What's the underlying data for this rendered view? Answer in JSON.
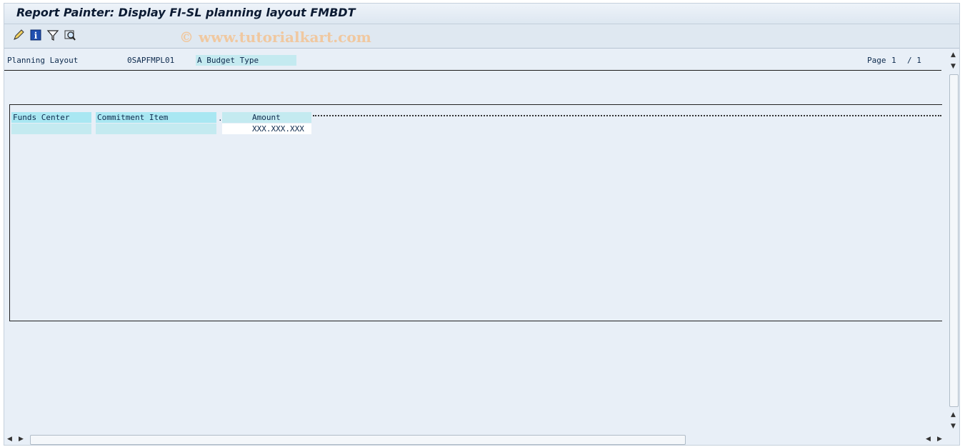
{
  "window": {
    "title": "Report Painter: Display FI-SL planning layout FMBDT"
  },
  "watermark": "© www.tutorialkart.com",
  "toolbar": {
    "icons": [
      "edit-pencil-icon",
      "info-icon",
      "filter-icon",
      "find-icon"
    ]
  },
  "header": {
    "label": "Planning Layout",
    "layout_id": "0SAPFMPL01",
    "description": "A Budget Type",
    "page_label": "Page",
    "page_current": "1",
    "page_total": "/ 1"
  },
  "table": {
    "columns": [
      "Funds Center",
      "Commitment Item",
      "Amount"
    ],
    "amount_value": "XXX.XXX.XXX"
  },
  "colors": {
    "cyan": "#a9e7f2",
    "background": "#e8eff7"
  }
}
